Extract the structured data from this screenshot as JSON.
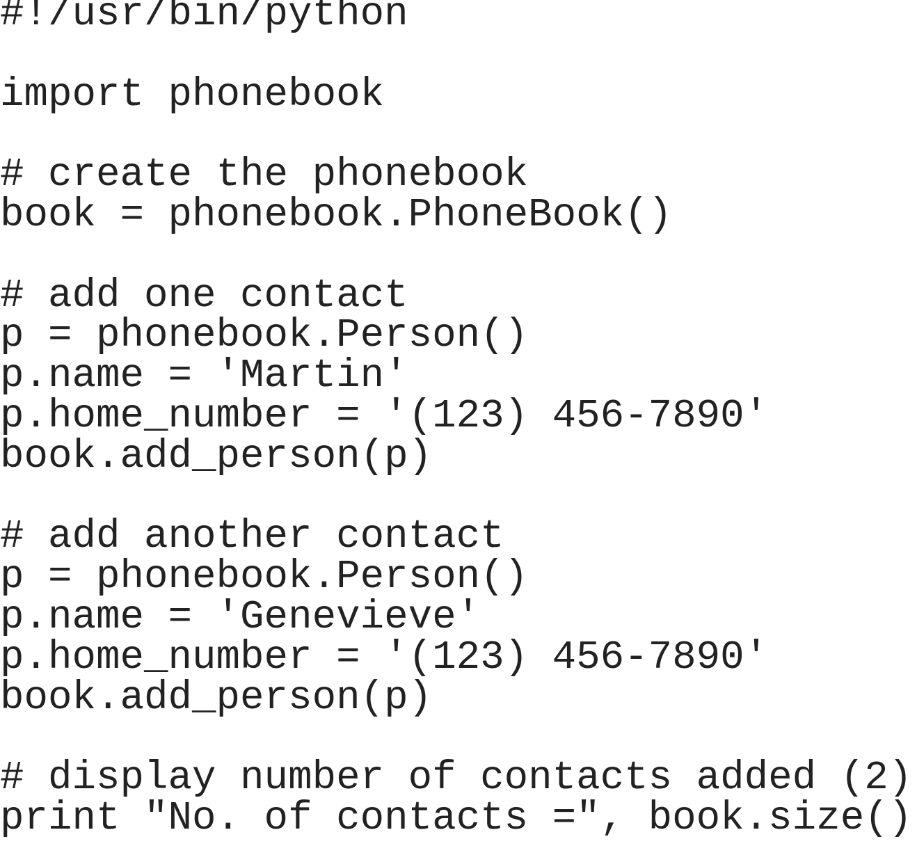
{
  "code": {
    "lines": [
      "#!/usr/bin/python",
      "",
      "import phonebook",
      "",
      "# create the phonebook",
      "book = phonebook.PhoneBook()",
      "",
      "# add one contact",
      "p = phonebook.Person()",
      "p.name = 'Martin'",
      "p.home_number = '(123) 456-7890'",
      "book.add_person(p)",
      "",
      "# add another contact",
      "p = phonebook.Person()",
      "p.name = 'Genevieve'",
      "p.home_number = '(123) 456-7890'",
      "book.add_person(p)",
      "",
      "# display number of contacts added (2)",
      "print \"No. of contacts =\", book.size()"
    ]
  }
}
